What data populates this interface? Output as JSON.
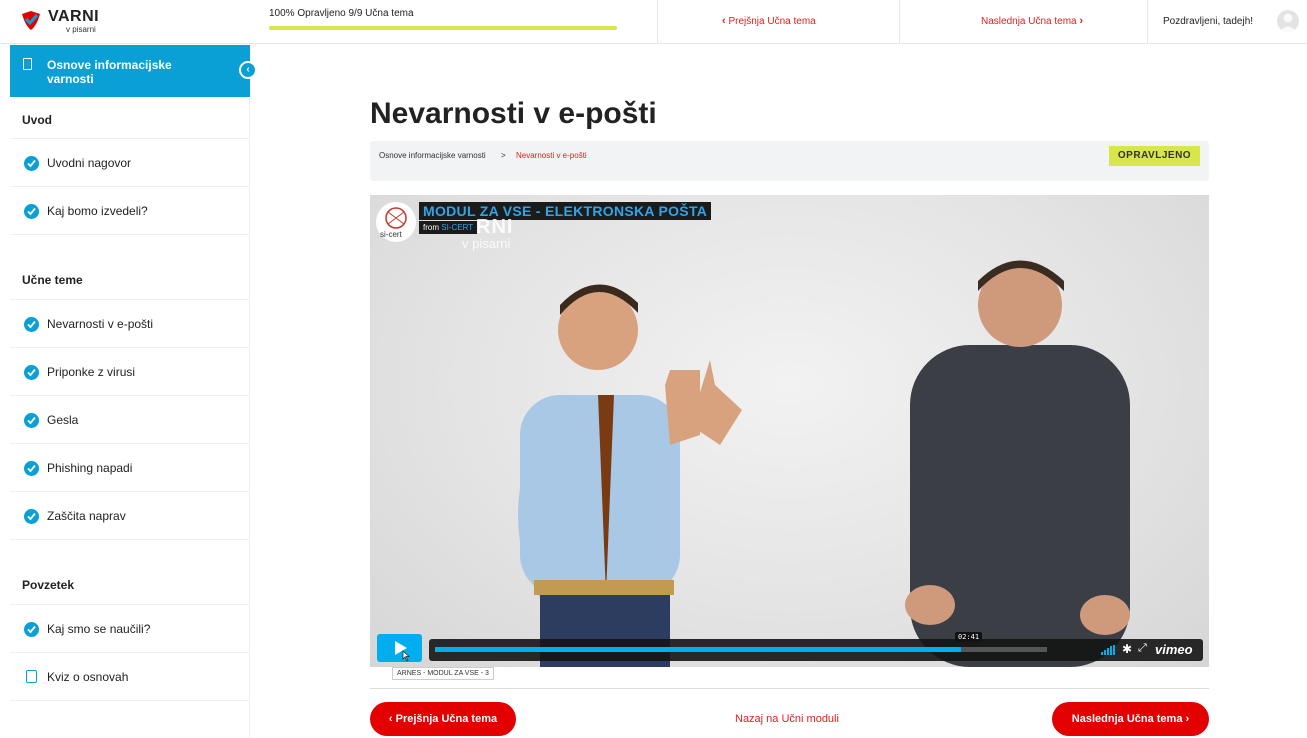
{
  "brand": {
    "name": "VARNI",
    "tagline": "v pisarni",
    "accent": "#e20000",
    "primary": "#0aa0d6",
    "done": "#d7e64b"
  },
  "header": {
    "progress_text": "100% Opravljeno 9/9 Učna tema",
    "progress_value": 1.0,
    "prev_label": "Prejšnja Učna tema",
    "next_label": "Naslednja Učna tema",
    "greeting": "Pozdravljeni, tadejh!"
  },
  "sidebar": {
    "course_title": "Osnove informacijske varnosti",
    "sections": [
      {
        "title": "Uvod",
        "items": [
          "Uvodni nagovor",
          "Kaj bomo izvedeli?"
        ]
      },
      {
        "title": "Učne teme",
        "items": [
          "Nevarnosti v e-pošti",
          "Priponke z virusi",
          "Gesla",
          "Phishing napadi",
          "Zaščita naprav"
        ]
      },
      {
        "title": "Povzetek",
        "items": [
          "Kaj smo se naučili?",
          "Kviz o osnovah"
        ]
      }
    ]
  },
  "main": {
    "title": "Nevarnosti v e-pošti",
    "breadcrumb": [
      "Osnove informacijske varnosti",
      ">",
      "Nevarnosti v e-pošti"
    ],
    "status_badge": "OPRAVLJENO"
  },
  "video": {
    "title": "MODUL ZA VSE - ELEKTRONSKA POŠTA",
    "from_label": "from",
    "from_source": "SI-CERT",
    "watermark_1": "RNI",
    "watermark_2": "v pisarni",
    "logo_text": "si-cert",
    "current_time": "02:41",
    "progress_value": 0.86,
    "player_brand": "vimeo",
    "caption": "ARNES - MODUL ZA VSE - 3"
  },
  "footer_nav": {
    "prev_button": "Prejšnja Učna tema",
    "back_link": "Nazaj na Učni moduli",
    "next_button": "Naslednja Učna tema"
  }
}
